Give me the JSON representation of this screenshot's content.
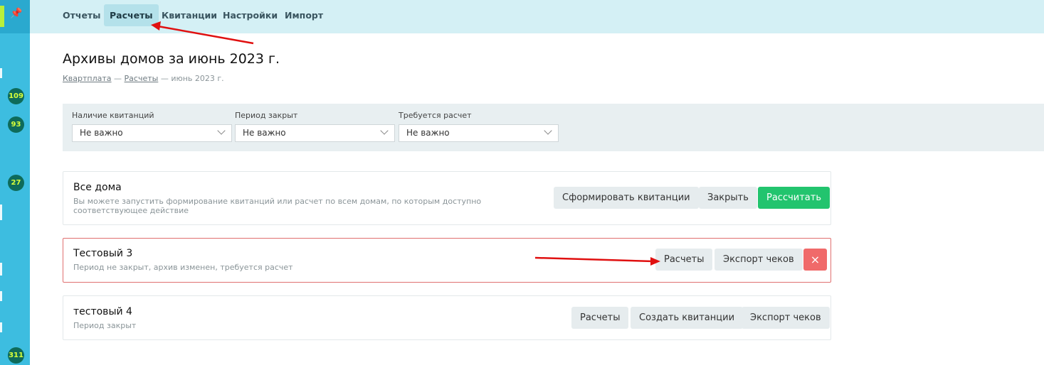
{
  "sidebar": {
    "badges": [
      "109",
      "93",
      "27",
      "311"
    ]
  },
  "nav": {
    "items": [
      {
        "label": "Отчеты"
      },
      {
        "label": "Расчеты"
      },
      {
        "label": "Квитанции"
      },
      {
        "label": "Настройки"
      },
      {
        "label": "Импорт"
      }
    ],
    "active": "Расчеты"
  },
  "page": {
    "title": "Архивы домов за июнь 2023 г.",
    "breadcrumb": {
      "link1": "Квартплата",
      "sep": " — ",
      "link2": "Расчеты",
      "current": "июнь 2023 г."
    }
  },
  "filters": [
    {
      "label": "Наличие квитанций",
      "value": "Не важно"
    },
    {
      "label": "Период закрыт",
      "value": "Не важно"
    },
    {
      "label": "Требуется расчет",
      "value": "Не важно"
    }
  ],
  "cards": {
    "all": {
      "title": "Все дома",
      "desc": "Вы можете запустить формирование квитанций или расчет по всем домам, по которым доступно соответствующее действие",
      "buttons": {
        "generate": "Сформировать квитанции",
        "close": "Закрыть",
        "calculate": "Рассчитать"
      }
    },
    "test3": {
      "title": "Тестовый 3",
      "desc": "Период не закрыт, архив изменен, требуется расчет",
      "buttons": {
        "calc": "Расчеты",
        "export": "Экспорт чеков",
        "delete": "×"
      }
    },
    "test4": {
      "title": "тестовый 4",
      "desc": "Период закрыт",
      "buttons": {
        "calc": "Расчеты",
        "create": "Создать квитанции",
        "export": "Экспорт чеков"
      }
    }
  },
  "colors": {
    "accent_green": "#22c46e",
    "danger": "#f06a6a",
    "nav_bg": "#d4f0f5",
    "sidebar": "#3dbde0",
    "arrow": "#e01010"
  }
}
